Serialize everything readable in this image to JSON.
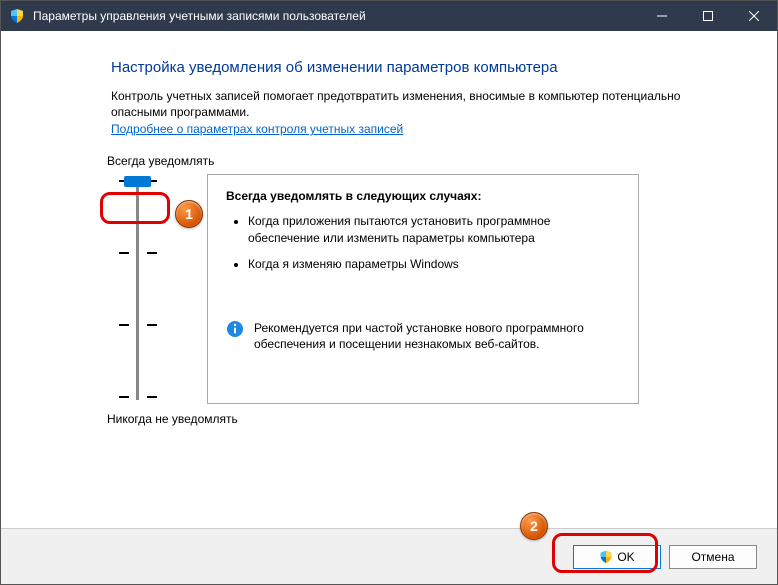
{
  "window": {
    "title": "Параметры управления учетными записями пользователей"
  },
  "heading": "Настройка уведомления об изменении параметров компьютера",
  "description": "Контроль учетных записей помогает предотвратить изменения, вносимые в компьютер потенциально опасными программами.",
  "link": "Подробнее о параметрах контроля учетных записей",
  "slider": {
    "top_label": "Всегда уведомлять",
    "bottom_label": "Никогда не уведомлять",
    "level": 3,
    "levels": 4
  },
  "panel": {
    "title": "Всегда уведомлять в следующих случаях:",
    "bullets": [
      "Когда приложения пытаются установить программное обеспечение или изменить параметры компьютера",
      "Когда я изменяю параметры Windows"
    ],
    "info": "Рекомендуется при частой установке нового программного обеспечения и посещении незнакомых веб-сайтов."
  },
  "buttons": {
    "ok": "OK",
    "cancel": "Отмена"
  },
  "callouts": {
    "one": "1",
    "two": "2"
  }
}
